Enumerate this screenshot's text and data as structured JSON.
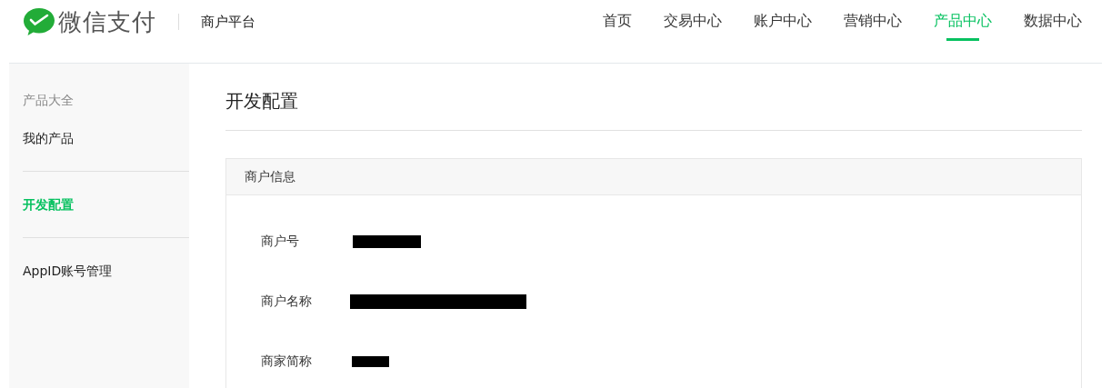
{
  "header": {
    "brand": "微信支付",
    "platform": "商户平台",
    "nav": [
      {
        "label": "首页",
        "selected": false
      },
      {
        "label": "交易中心",
        "selected": false
      },
      {
        "label": "账户中心",
        "selected": false
      },
      {
        "label": "营销中心",
        "selected": false
      },
      {
        "label": "产品中心",
        "selected": true
      },
      {
        "label": "数据中心",
        "selected": false
      }
    ]
  },
  "sidebar": {
    "sections": [
      {
        "title": "产品大全",
        "items": [
          {
            "label": "我的产品",
            "selected": false
          }
        ]
      },
      {
        "items": [
          {
            "label": "开发配置",
            "selected": true
          }
        ]
      },
      {
        "items": [
          {
            "label": "AppID账号管理",
            "selected": false
          }
        ]
      }
    ]
  },
  "main": {
    "title": "开发配置",
    "card": {
      "title": "商户信息",
      "fields": [
        {
          "label": "商户号",
          "redacted": true
        },
        {
          "label": "商户名称",
          "redacted": true
        },
        {
          "label": "商家简称",
          "redacted": true
        }
      ]
    }
  }
}
